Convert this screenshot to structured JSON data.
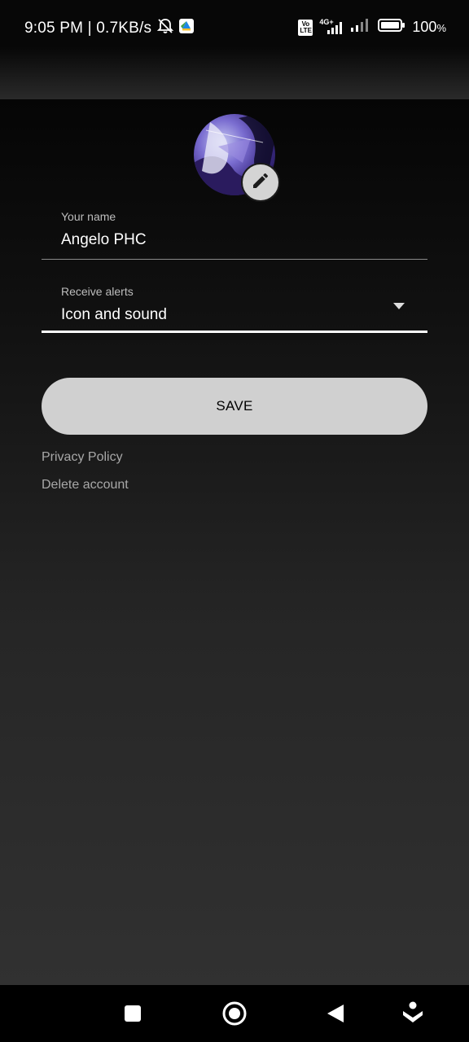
{
  "status_bar": {
    "time_speed": "9:05 PM | 0.7KB/s",
    "network_label": "4G+",
    "volte_label": "Vo LTE",
    "battery_percent": "100",
    "battery_suffix": "%"
  },
  "profile": {
    "name_label": "Your name",
    "name_value": "Angelo PHC",
    "alerts_label": "Receive alerts",
    "alerts_value": "Icon and sound"
  },
  "actions": {
    "save_label": "SAVE",
    "privacy_label": "Privacy Policy",
    "delete_label": "Delete account"
  }
}
